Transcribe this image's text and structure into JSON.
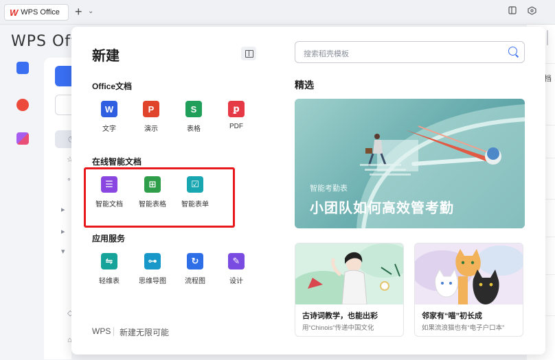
{
  "window": {
    "app_tab_label": "WPS Office",
    "new_tab_symbol": "+",
    "tab_dropdown_symbol": "⌄"
  },
  "background": {
    "brand_fragment": "WPS Off",
    "right_edge_text": "档"
  },
  "modal": {
    "title": "新建",
    "sections": {
      "office_docs": {
        "title": "Office文档",
        "items": [
          {
            "label": "文字",
            "icon": "word-icon",
            "glyph": "W",
            "color": "#2f5fe0"
          },
          {
            "label": "演示",
            "icon": "presentation-icon",
            "glyph": "P",
            "color": "#e0452b"
          },
          {
            "label": "表格",
            "icon": "spreadsheet-icon",
            "glyph": "S",
            "color": "#1f9f5a"
          },
          {
            "label": "PDF",
            "icon": "pdf-icon",
            "glyph": "ꝑ",
            "color": "#e63946"
          }
        ]
      },
      "smart_docs": {
        "title": "在线智能文档",
        "items": [
          {
            "label": "智能文档",
            "icon": "smart-doc-icon",
            "glyph": "☰",
            "color": "#8a46e0"
          },
          {
            "label": "智能表格",
            "icon": "smart-sheet-icon",
            "glyph": "⊞",
            "color": "#2f9e4a"
          },
          {
            "label": "智能表单",
            "icon": "smart-form-icon",
            "glyph": "☑",
            "color": "#18a6b0"
          }
        ]
      },
      "app_services": {
        "title": "应用服务",
        "items": [
          {
            "label": "轻维表",
            "icon": "light-table-icon",
            "glyph": "⇋",
            "color": "#16a39a"
          },
          {
            "label": "思维导图",
            "icon": "mindmap-icon",
            "glyph": "⊶",
            "color": "#1798c9"
          },
          {
            "label": "流程图",
            "icon": "flowchart-icon",
            "glyph": "↻",
            "color": "#2e6fe8"
          },
          {
            "label": "设计",
            "icon": "design-icon",
            "glyph": "✎",
            "color": "#7a4be0"
          }
        ]
      }
    },
    "footer": {
      "brand": "WPS",
      "slogan": "新建无限可能"
    },
    "search": {
      "placeholder": "搜索稻壳模板"
    },
    "featured": {
      "title": "精选",
      "banner": {
        "tag": "智能考勤表",
        "headline": "小团队如何高效管考勤"
      },
      "cards": [
        {
          "title": "古诗词教学，也能出彩",
          "subtitle": "用“Chinois”传递中国文化"
        },
        {
          "title": "邻家有“喵”初长成",
          "subtitle": "如果流浪猫也有“电子户口本”"
        }
      ]
    }
  },
  "colors": {
    "accent": "#3a6ff2",
    "highlight": "#e8191d"
  }
}
